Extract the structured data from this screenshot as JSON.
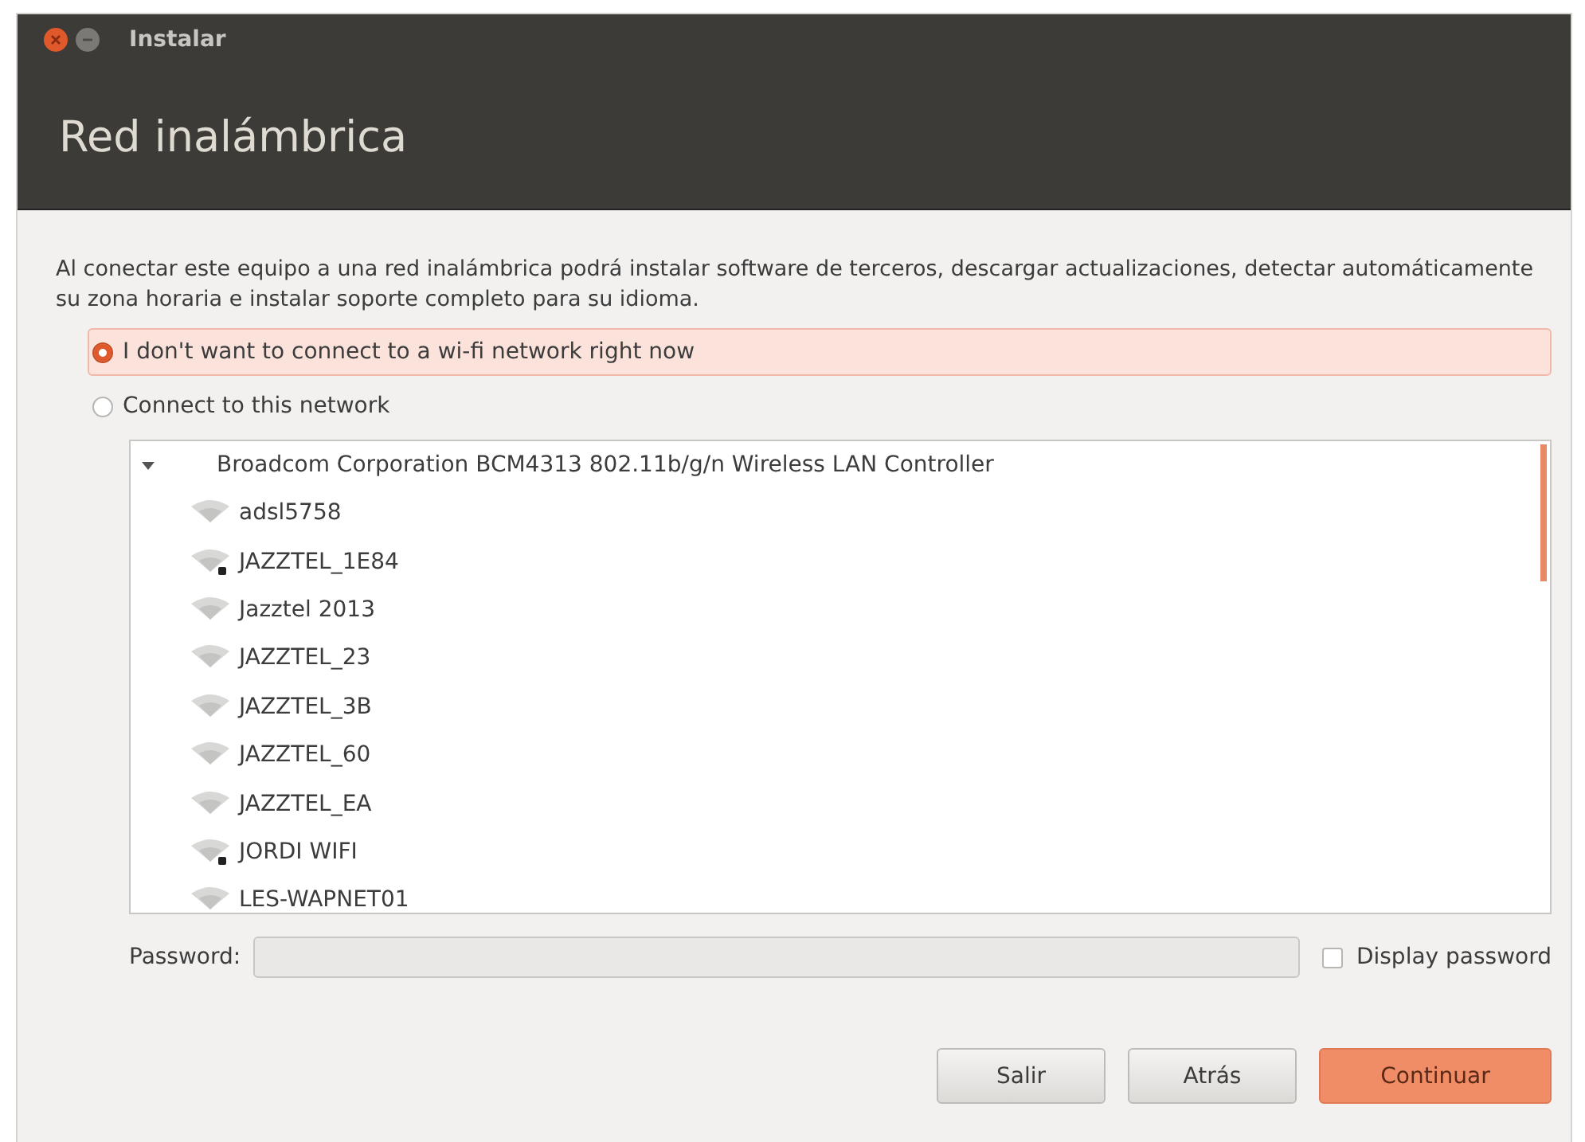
{
  "window": {
    "title": "Instalar",
    "heading": "Red inalámbrica"
  },
  "description": "Al conectar este equipo a una red inalámbrica podrá instalar software de terceros, descargar actualizaciones, detectar automáticamente su zona horaria e instalar soporte completo para su idioma.",
  "options": [
    {
      "label": "I don't want to connect to a wi-fi network right now",
      "selected": true
    },
    {
      "label": "Connect to this network",
      "selected": false
    }
  ],
  "device": {
    "label": "Broadcom Corporation BCM4313 802.11b/g/n Wireless LAN Controller",
    "expanded": true,
    "children": [
      {
        "name": "adsl5758",
        "locked": false
      },
      {
        "name": "JAZZTEL_1E84",
        "locked": true
      },
      {
        "name": "Jazztel 2013",
        "locked": false
      },
      {
        "name": "JAZZTEL_23",
        "locked": false
      },
      {
        "name": "JAZZTEL_3B",
        "locked": false
      },
      {
        "name": "JAZZTEL_60",
        "locked": false
      },
      {
        "name": "JAZZTEL_EA",
        "locked": false
      },
      {
        "name": "JORDI WIFI",
        "locked": true
      },
      {
        "name": "LES-WAPNET01",
        "locked": false
      }
    ]
  },
  "password": {
    "label": "Password:",
    "disabled": true
  },
  "display_password": {
    "label": "Display password",
    "checked": false
  },
  "buttons": [
    {
      "label": "Salir",
      "kind": "normal"
    },
    {
      "label": "Atrás",
      "kind": "normal"
    },
    {
      "label": "Continuar",
      "kind": "primary"
    }
  ]
}
